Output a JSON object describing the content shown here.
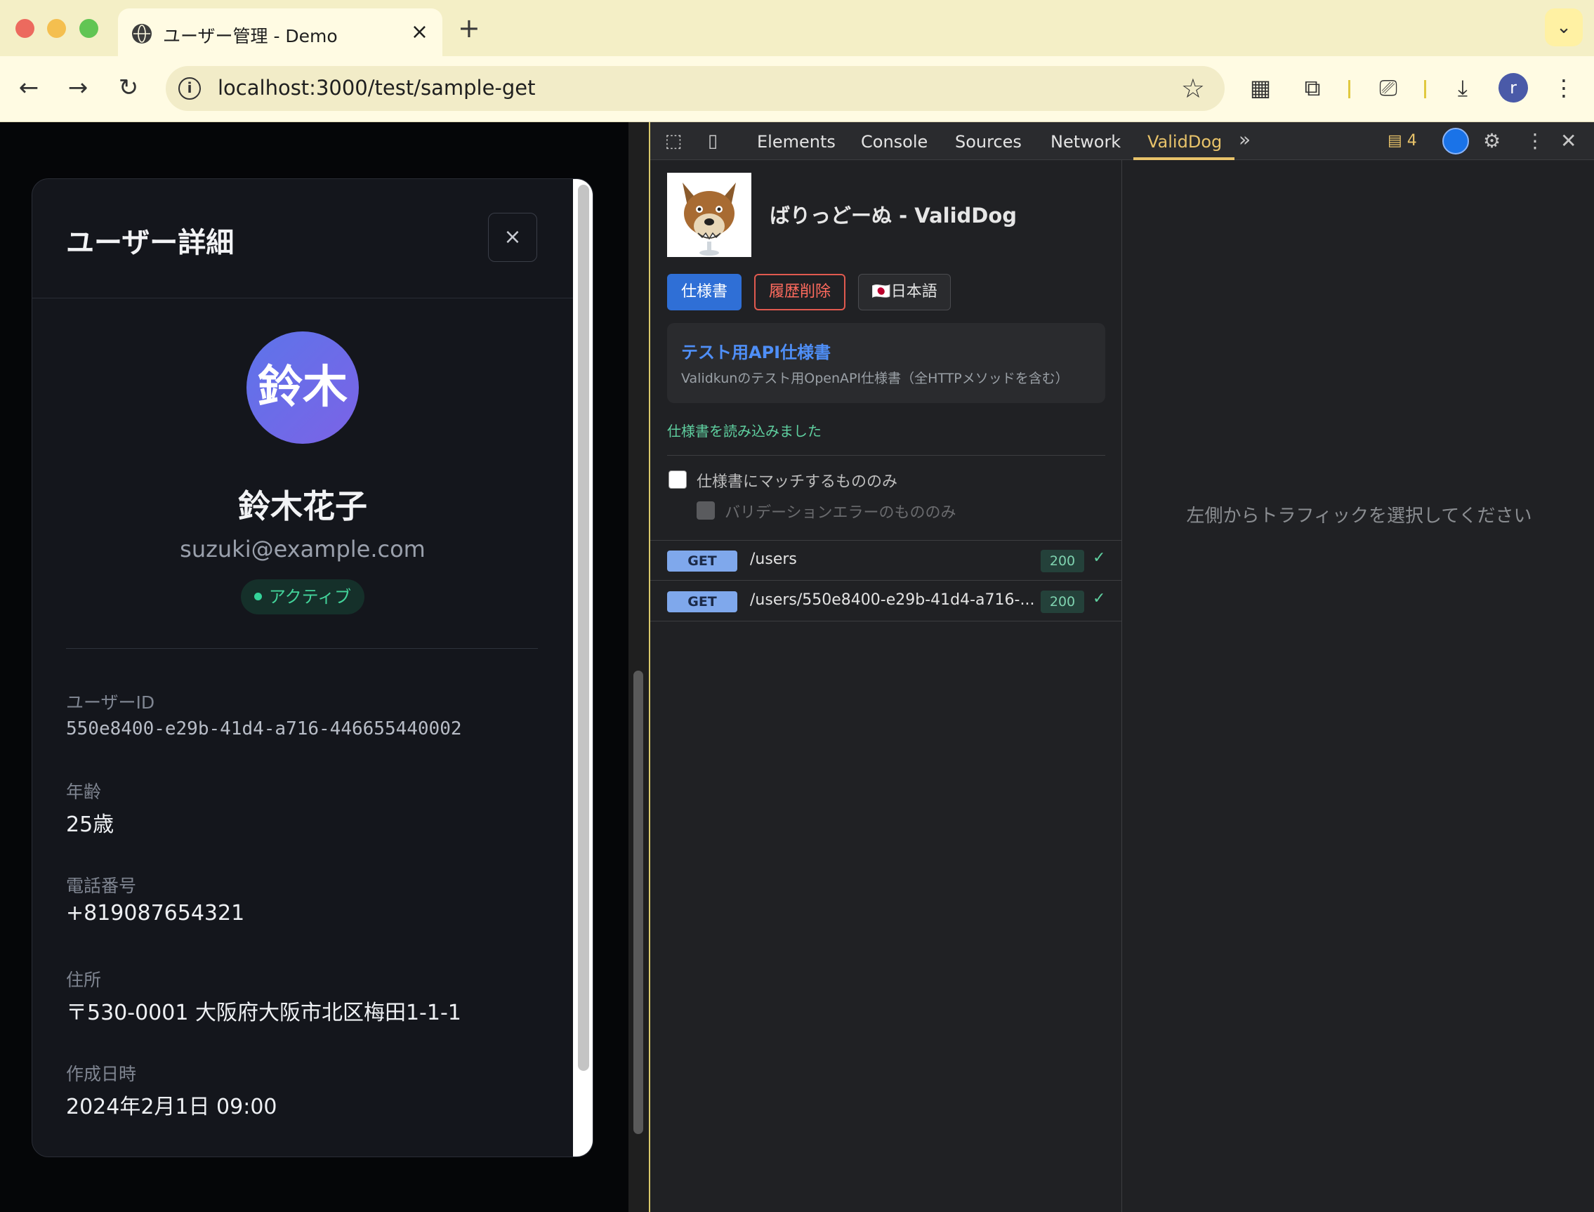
{
  "browser": {
    "tab_title": "ユーザー管理 - Demo",
    "url": "localhost:3000/test/sample-get"
  },
  "modal": {
    "title": "ユーザー詳細",
    "close_label": "×",
    "avatar_text": "鈴木",
    "name": "鈴木花子",
    "email": "suzuki@example.com",
    "status": "アクティブ",
    "fields": [
      {
        "label": "ユーザーID",
        "value": "550e8400-e29b-41d4-a716-446655440002"
      },
      {
        "label": "年齢",
        "value": "25歳"
      },
      {
        "label": "電話番号",
        "value": "+819087654321"
      },
      {
        "label": "住所",
        "value": "〒530-0001 大阪府大阪市北区梅田1-1-1"
      },
      {
        "label": "作成日時",
        "value": "2024年2月1日 09:00"
      }
    ]
  },
  "devtools": {
    "tabs": [
      "Elements",
      "Console",
      "Sources",
      "Network",
      "ValidDog"
    ],
    "active_tab": "ValidDog",
    "issues_count": "4"
  },
  "validdog": {
    "title": "ばりっどーぬ - ValidDog",
    "btn_spec": "仕様書",
    "btn_clear": "履歴削除",
    "btn_lang": "🇯🇵日本語",
    "spec_title": "テスト用API仕様書",
    "spec_desc": "Validkunのテスト用OpenAPI仕様書（全HTTPメソッドを含む）",
    "spec_loaded": "仕様書を読み込みました",
    "filter_match": "仕様書にマッチするもののみ",
    "filter_error": "バリデーションエラーのもののみ",
    "traffic": [
      {
        "method": "GET",
        "path": "/users",
        "status": "200",
        "check": "✓"
      },
      {
        "method": "GET",
        "path": "/users/550e8400-e29b-41d4-a716-...",
        "status": "200",
        "check": "✓"
      }
    ],
    "detail_empty": "左側からトラフィックを選択してください"
  },
  "colors": {
    "accent": "#2f6fd6",
    "danger": "#e05a4f",
    "success": "#34d399",
    "validdog_tab": "#e8c36a"
  }
}
